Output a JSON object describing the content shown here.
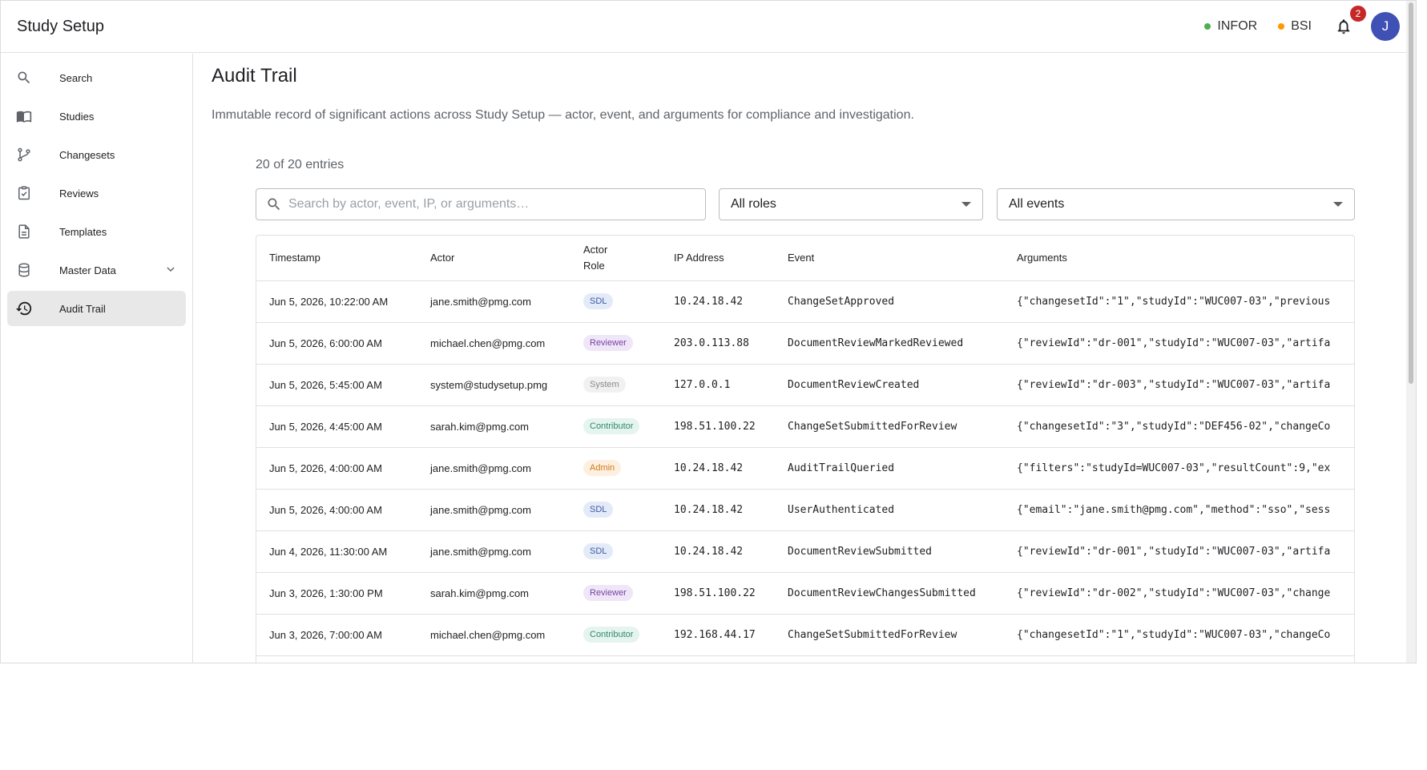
{
  "app": {
    "title": "Study Setup"
  },
  "topbar": {
    "envs": [
      {
        "label": "INFOR",
        "color": "#4caf50"
      },
      {
        "label": "BSI",
        "color": "#ff9800"
      }
    ],
    "notifications_count": "2",
    "avatar_initial": "J"
  },
  "sidebar": {
    "items": [
      {
        "label": "Search",
        "icon": "search-icon"
      },
      {
        "label": "Studies",
        "icon": "book-icon"
      },
      {
        "label": "Changesets",
        "icon": "branch-icon"
      },
      {
        "label": "Reviews",
        "icon": "clipboard-check-icon"
      },
      {
        "label": "Templates",
        "icon": "document-icon"
      },
      {
        "label": "Master Data",
        "icon": "database-icon"
      },
      {
        "label": "Audit Trail",
        "icon": "history-icon",
        "active": true
      }
    ]
  },
  "page": {
    "title": "Audit Trail",
    "description": "Immutable record of significant actions across Study Setup — actor, event, and arguments for compliance and investigation.",
    "count": "20 of 20 entries",
    "search_placeholder": "Search by actor, event, IP, or arguments…",
    "roles_filter": "All roles",
    "events_filter": "All events"
  },
  "table": {
    "headers": {
      "timestamp": "Timestamp",
      "actor": "Actor",
      "role_line1": "Actor",
      "role_line2": "Role",
      "ip": "IP Address",
      "event": "Event",
      "arguments": "Arguments"
    },
    "rows": [
      {
        "timestamp": "Jun 5, 2026, 10:22:00 AM",
        "actor": "jane.smith@pmg.com",
        "role": "SDL",
        "ip": "10.24.18.42",
        "event": "ChangeSetApproved",
        "arguments": "{\"changesetId\":\"1\",\"studyId\":\"WUC007-03\",\"previous"
      },
      {
        "timestamp": "Jun 5, 2026, 6:00:00 AM",
        "actor": "michael.chen@pmg.com",
        "role": "Reviewer",
        "ip": "203.0.113.88",
        "event": "DocumentReviewMarkedReviewed",
        "arguments": "{\"reviewId\":\"dr-001\",\"studyId\":\"WUC007-03\",\"artifa"
      },
      {
        "timestamp": "Jun 5, 2026, 5:45:00 AM",
        "actor": "system@studysetup.pmg",
        "role": "System",
        "ip": "127.0.0.1",
        "event": "DocumentReviewCreated",
        "arguments": "{\"reviewId\":\"dr-003\",\"studyId\":\"WUC007-03\",\"artifa"
      },
      {
        "timestamp": "Jun 5, 2026, 4:45:00 AM",
        "actor": "sarah.kim@pmg.com",
        "role": "Contributor",
        "ip": "198.51.100.22",
        "event": "ChangeSetSubmittedForReview",
        "arguments": "{\"changesetId\":\"3\",\"studyId\":\"DEF456-02\",\"changeCo"
      },
      {
        "timestamp": "Jun 5, 2026, 4:00:00 AM",
        "actor": "jane.smith@pmg.com",
        "role": "Admin",
        "ip": "10.24.18.42",
        "event": "AuditTrailQueried",
        "arguments": "{\"filters\":\"studyId=WUC007-03\",\"resultCount\":9,\"ex"
      },
      {
        "timestamp": "Jun 5, 2026, 4:00:00 AM",
        "actor": "jane.smith@pmg.com",
        "role": "SDL",
        "ip": "10.24.18.42",
        "event": "UserAuthenticated",
        "arguments": "{\"email\":\"jane.smith@pmg.com\",\"method\":\"sso\",\"sess"
      },
      {
        "timestamp": "Jun 4, 2026, 11:30:00 AM",
        "actor": "jane.smith@pmg.com",
        "role": "SDL",
        "ip": "10.24.18.42",
        "event": "DocumentReviewSubmitted",
        "arguments": "{\"reviewId\":\"dr-001\",\"studyId\":\"WUC007-03\",\"artifa"
      },
      {
        "timestamp": "Jun 3, 2026, 1:30:00 PM",
        "actor": "sarah.kim@pmg.com",
        "role": "Reviewer",
        "ip": "198.51.100.22",
        "event": "DocumentReviewChangesSubmitted",
        "arguments": "{\"reviewId\":\"dr-002\",\"studyId\":\"WUC007-03\",\"change"
      },
      {
        "timestamp": "Jun 3, 2026, 7:00:00 AM",
        "actor": "michael.chen@pmg.com",
        "role": "Contributor",
        "ip": "192.168.44.17",
        "event": "ChangeSetSubmittedForReview",
        "arguments": "{\"changesetId\":\"1\",\"studyId\":\"WUC007-03\",\"changeCo"
      }
    ]
  },
  "role_colors": {
    "SDL": {
      "bg": "#e3eaf8",
      "fg": "#3f5aa6"
    },
    "Reviewer": {
      "bg": "#efe6f7",
      "fg": "#7b3fa8"
    },
    "System": {
      "bg": "#f1f1f1",
      "fg": "#8a8a8a"
    },
    "Contributor": {
      "bg": "#e5f4ee",
      "fg": "#2e8b6a"
    },
    "Admin": {
      "bg": "#fdf0e1",
      "fg": "#d07a1c"
    }
  }
}
